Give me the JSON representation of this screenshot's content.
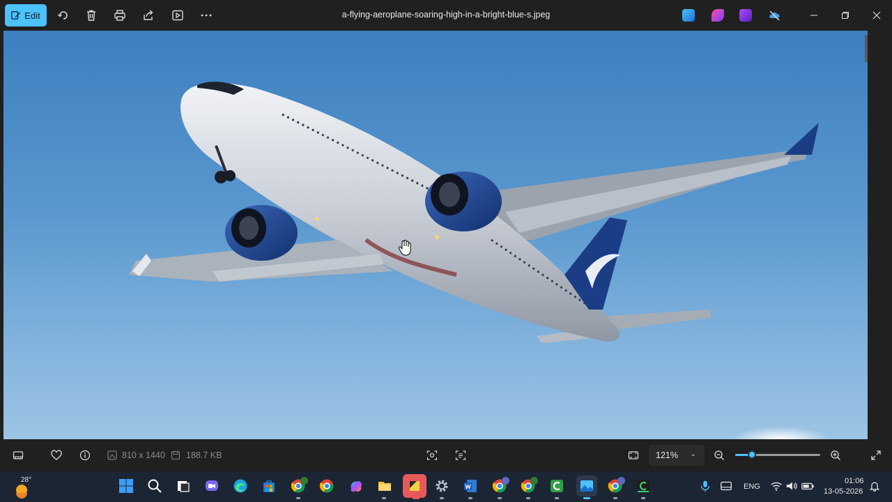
{
  "toolbar": {
    "edit_label": "Edit",
    "file_title": "a-flying-aeroplane-soaring-high-in-a-bright-blue-s.jpeg",
    "icons": [
      "rotate-icon",
      "delete-icon",
      "print-icon",
      "share-icon",
      "slideshow-icon",
      "more-icon"
    ]
  },
  "window_controls": [
    "minimize-icon",
    "restore-icon",
    "close-icon"
  ],
  "image": {
    "subject": "",
    "sky_color": "#5a98cf"
  },
  "statusbar": {
    "dimensions": "810 x 1440",
    "file_size": "188.7 KB",
    "zoom_value": "121%",
    "zoom_level": 0.2
  },
  "taskbar": {
    "weather_temp": "28°",
    "language": "ENG",
    "time": "01:06",
    "date": "13-05-2026"
  },
  "colors": {
    "accent": "#4cc2ff",
    "background": "#202020",
    "taskbar": "#1c2533"
  }
}
